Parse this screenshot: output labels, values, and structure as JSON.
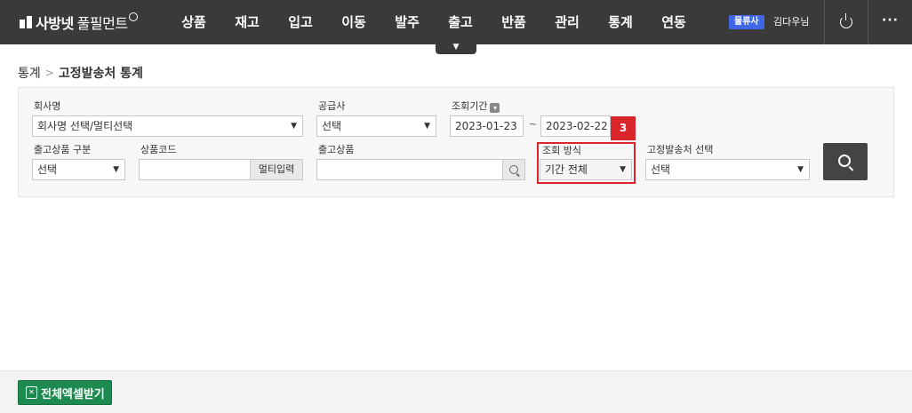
{
  "logo": {
    "text": "사방넷",
    "sub": "풀필먼트"
  },
  "nav": {
    "items": [
      "상품",
      "재고",
      "입고",
      "이동",
      "발주",
      "출고",
      "반품",
      "관리",
      "통계",
      "연동"
    ]
  },
  "user": {
    "role_badge": "물류사",
    "name": "김다우님"
  },
  "icons": {
    "power": "power-icon",
    "more": "more-icon",
    "search": "search-icon",
    "excel": "excel-icon"
  },
  "breadcrumb": {
    "parent": "통계",
    "current": "고정발송처 통계"
  },
  "filters": {
    "company": {
      "label": "회사명",
      "value": "회사명 선택/멀티선택"
    },
    "supplier": {
      "label": "공급사",
      "value": "선택"
    },
    "period": {
      "label": "조회기간",
      "start": "2023-01-23",
      "sep": "~",
      "end": "2023-02-22"
    },
    "ship_type": {
      "label": "출고상품 구분",
      "value": "선택"
    },
    "product_code": {
      "label": "상품코드",
      "value": "",
      "multi_button": "멀티입력"
    },
    "ship_product": {
      "label": "출고상품",
      "value": ""
    },
    "query_method": {
      "label": "조회 방식",
      "value": "기간 전체"
    },
    "fixed_dest": {
      "label": "고정발송처 선택",
      "value": "선택"
    }
  },
  "step_badge": "3",
  "footer": {
    "excel_button": "전체엑셀받기"
  },
  "colors": {
    "topbar": "#3a3a3a",
    "accent_blue": "#3f67e6",
    "highlight_red": "#d9262a",
    "excel_green": "#1d8a4f"
  }
}
